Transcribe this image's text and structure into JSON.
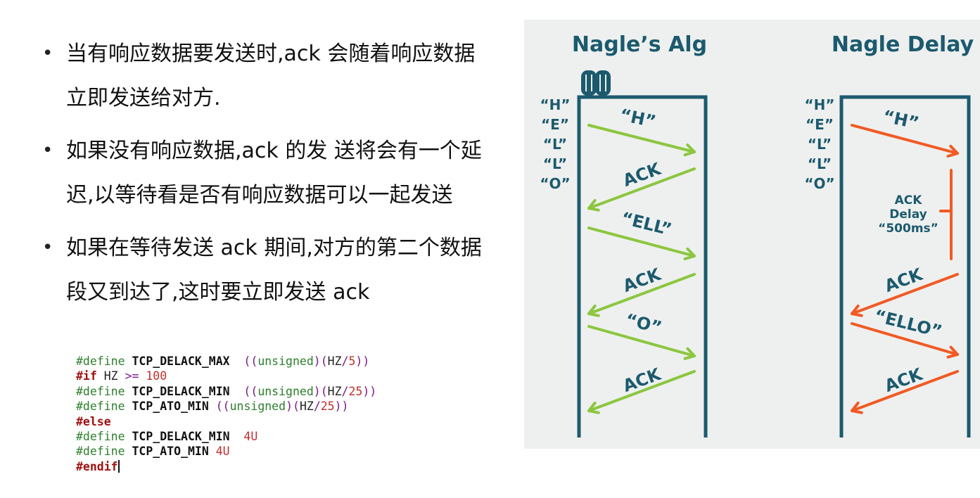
{
  "bullets": [
    "当有响应数据要发送时,ack 会随着响应数据立即发送给对方.",
    "如果没有响应数据,ack 的发 送将会有一个延迟,以等待看是否有响应数据可以一起发送",
    "如果在等待发送 ack 期间,对方的第二个数据段又到达了,这时要立即发送 ack"
  ],
  "code_lines": [
    [
      {
        "t": "#define ",
        "c": "kw-def"
      },
      {
        "t": "TCP_DELACK_MAX",
        "c": "name"
      },
      {
        "t": "  ((",
        "c": "punc"
      },
      {
        "t": "unsigned",
        "c": "str"
      },
      {
        "t": ")(",
        "c": "punc"
      },
      {
        "t": "HZ",
        "c": "plain"
      },
      {
        "t": "/",
        "c": "punc"
      },
      {
        "t": "5",
        "c": "num"
      },
      {
        "t": "))",
        "c": "punc"
      }
    ],
    [
      {
        "t": "#if",
        "c": "kw-pp"
      },
      {
        "t": " HZ ",
        "c": "plain"
      },
      {
        "t": ">=",
        "c": "punc"
      },
      {
        "t": " 100",
        "c": "num"
      }
    ],
    [
      {
        "t": "#define ",
        "c": "kw-def"
      },
      {
        "t": "TCP_DELACK_MIN",
        "c": "name"
      },
      {
        "t": "  ((",
        "c": "punc"
      },
      {
        "t": "unsigned",
        "c": "str"
      },
      {
        "t": ")(",
        "c": "punc"
      },
      {
        "t": "HZ",
        "c": "plain"
      },
      {
        "t": "/",
        "c": "punc"
      },
      {
        "t": "25",
        "c": "num"
      },
      {
        "t": "))",
        "c": "punc"
      }
    ],
    [
      {
        "t": "#define ",
        "c": "kw-def"
      },
      {
        "t": "TCP_ATO_MIN",
        "c": "name"
      },
      {
        "t": " ((",
        "c": "punc"
      },
      {
        "t": "unsigned",
        "c": "str"
      },
      {
        "t": ")(",
        "c": "punc"
      },
      {
        "t": "HZ",
        "c": "plain"
      },
      {
        "t": "/",
        "c": "punc"
      },
      {
        "t": "25",
        "c": "num"
      },
      {
        "t": "))",
        "c": "punc"
      }
    ],
    [
      {
        "t": "#else",
        "c": "kw-pp"
      }
    ],
    [
      {
        "t": "#define ",
        "c": "kw-def"
      },
      {
        "t": "TCP_DELACK_MIN",
        "c": "name"
      },
      {
        "t": "  4U",
        "c": "num"
      }
    ],
    [
      {
        "t": "#define ",
        "c": "kw-def"
      },
      {
        "t": "TCP_ATO_MIN",
        "c": "name"
      },
      {
        "t": " 4U",
        "c": "num"
      }
    ],
    [
      {
        "t": "#endif",
        "c": "kw-pp"
      }
    ]
  ],
  "diagram": {
    "colors": {
      "background": "#eef0ef",
      "line": "#1c5a6e",
      "green": "#8cc63f",
      "orange": "#f15a24",
      "text": "#1c5a6e"
    },
    "left": {
      "title": "Nagle’s Alg",
      "letters": [
        "“H”",
        "“E”",
        "“L”",
        "“L”",
        "“O”"
      ],
      "arrows": [
        {
          "label": "“H”",
          "dir": "right"
        },
        {
          "label": "ACK",
          "dir": "left"
        },
        {
          "label": "“ELL”",
          "dir": "right"
        },
        {
          "label": "ACK",
          "dir": "left"
        },
        {
          "label": "“O”",
          "dir": "right"
        },
        {
          "label": "ACK",
          "dir": "left"
        }
      ]
    },
    "right": {
      "title": "Nagle Delay",
      "letters": [
        "“H”",
        "“E”",
        "“L”",
        "“L”",
        "“O”"
      ],
      "delay_label": [
        "ACK",
        "Delay",
        "“500ms”"
      ],
      "arrows": [
        {
          "label": "“H”",
          "dir": "right"
        },
        {
          "label": "ACK",
          "dir": "left"
        },
        {
          "label": "“ELLO”",
          "dir": "right"
        },
        {
          "label": "ACK",
          "dir": "left"
        }
      ]
    }
  }
}
